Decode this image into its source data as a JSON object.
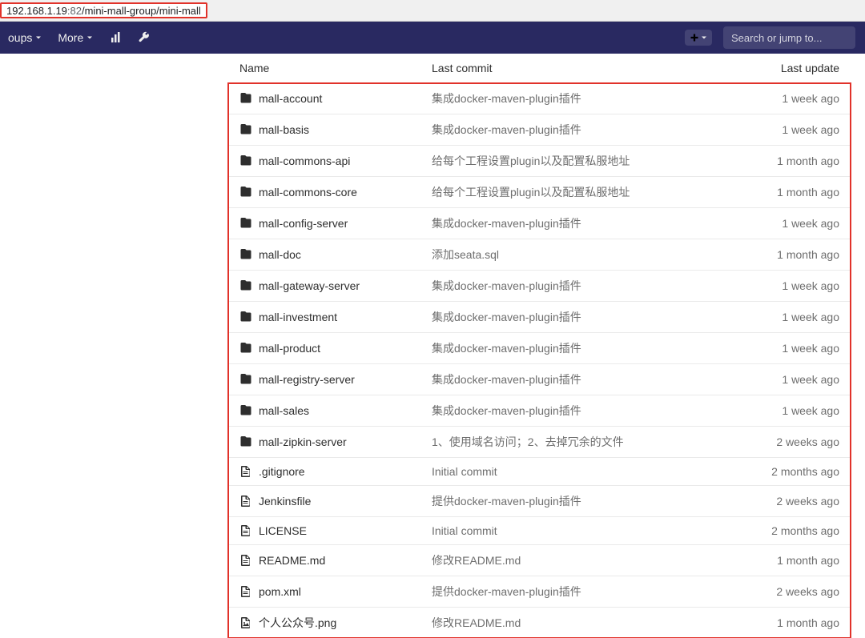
{
  "address": {
    "host": "192.168.1.19",
    "port": ":82",
    "path": "/mini-mall-group/mini-mall"
  },
  "navbar": {
    "groups": "oups",
    "more": "More",
    "search_placeholder": "Search or jump to..."
  },
  "table": {
    "headers": {
      "name": "Name",
      "commit": "Last commit",
      "update": "Last update"
    },
    "rows": [
      {
        "icon": "folder",
        "name": "mall-account",
        "commit": "集成docker-maven-plugin插件",
        "update": "1 week ago"
      },
      {
        "icon": "folder",
        "name": "mall-basis",
        "commit": "集成docker-maven-plugin插件",
        "update": "1 week ago"
      },
      {
        "icon": "folder",
        "name": "mall-commons-api",
        "commit": "给每个工程设置plugin以及配置私服地址",
        "update": "1 month ago"
      },
      {
        "icon": "folder",
        "name": "mall-commons-core",
        "commit": "给每个工程设置plugin以及配置私服地址",
        "update": "1 month ago"
      },
      {
        "icon": "folder",
        "name": "mall-config-server",
        "commit": "集成docker-maven-plugin插件",
        "update": "1 week ago"
      },
      {
        "icon": "folder",
        "name": "mall-doc",
        "commit": "添加seata.sql",
        "update": "1 month ago"
      },
      {
        "icon": "folder",
        "name": "mall-gateway-server",
        "commit": "集成docker-maven-plugin插件",
        "update": "1 week ago"
      },
      {
        "icon": "folder",
        "name": "mall-investment",
        "commit": "集成docker-maven-plugin插件",
        "update": "1 week ago"
      },
      {
        "icon": "folder",
        "name": "mall-product",
        "commit": "集成docker-maven-plugin插件",
        "update": "1 week ago"
      },
      {
        "icon": "folder",
        "name": "mall-registry-server",
        "commit": "集成docker-maven-plugin插件",
        "update": "1 week ago"
      },
      {
        "icon": "folder",
        "name": "mall-sales",
        "commit": "集成docker-maven-plugin插件",
        "update": "1 week ago"
      },
      {
        "icon": "folder",
        "name": "mall-zipkin-server",
        "commit": "1、使用域名访问；2、去掉冗余的文件",
        "update": "2 weeks ago"
      },
      {
        "icon": "file",
        "name": ".gitignore",
        "commit": "Initial commit",
        "update": "2 months ago"
      },
      {
        "icon": "file",
        "name": "Jenkinsfile",
        "commit": "提供docker-maven-plugin插件",
        "update": "2 weeks ago"
      },
      {
        "icon": "file",
        "name": "LICENSE",
        "commit": "Initial commit",
        "update": "2 months ago"
      },
      {
        "icon": "file",
        "name": "README.md",
        "commit": "修改README.md",
        "update": "1 month ago"
      },
      {
        "icon": "file",
        "name": "pom.xml",
        "commit": "提供docker-maven-plugin插件",
        "update": "2 weeks ago"
      },
      {
        "icon": "image",
        "name": "个人公众号.png",
        "commit": "修改README.md",
        "update": "1 month ago"
      }
    ]
  }
}
